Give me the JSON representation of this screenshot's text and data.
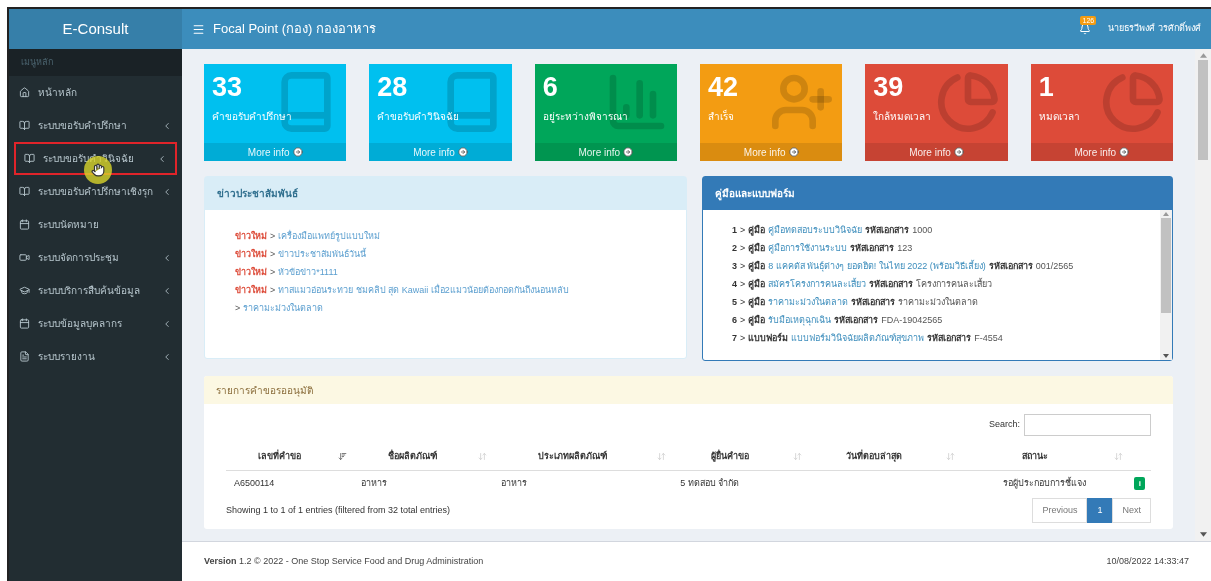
{
  "app": {
    "title": "E-Consult"
  },
  "header": {
    "title": "Focal Point (กอง) กองอาหาร",
    "notification_count": "126",
    "user": "นายธรวีพงศ์ วรศักดิ์พงศ์"
  },
  "sidebar": {
    "section": "เมนูหลัก",
    "items": [
      {
        "label": "หน้าหลัก",
        "has_submenu": false,
        "highlighted": false
      },
      {
        "label": "ระบบขอรับคำปรึกษา",
        "has_submenu": true,
        "highlighted": false
      },
      {
        "label": "ระบบขอรับคำวินิจฉัย",
        "has_submenu": true,
        "highlighted": true
      },
      {
        "label": "ระบบขอรับคำปรึกษาเชิงรุก",
        "has_submenu": true,
        "highlighted": false
      },
      {
        "label": "ระบบนัดหมาย",
        "has_submenu": false,
        "highlighted": false
      },
      {
        "label": "ระบบจัดการประชุม",
        "has_submenu": true,
        "highlighted": false
      },
      {
        "label": "ระบบบริการสืบค้นข้อมูล",
        "has_submenu": true,
        "highlighted": false
      },
      {
        "label": "ระบบข้อมูลบุคลากร",
        "has_submenu": true,
        "highlighted": false
      },
      {
        "label": "ระบบรายงาน",
        "has_submenu": true,
        "highlighted": false
      }
    ]
  },
  "stats": [
    {
      "value": "33",
      "label": "คำขอรับคำปรึกษา",
      "link": "More info",
      "color": "#00c0ef",
      "kind": "book"
    },
    {
      "value": "28",
      "label": "คำขอรับคำวินิจฉัย",
      "link": "More info",
      "color": "#00c0ef",
      "kind": "book"
    },
    {
      "value": "6",
      "label": "อยู่ระหว่างพิจารณา",
      "link": "More info",
      "color": "#00a65a",
      "kind": "chart"
    },
    {
      "value": "42",
      "label": "สำเร็จ",
      "link": "More info",
      "color": "#f39c12",
      "kind": "user"
    },
    {
      "value": "39",
      "label": "ใกล้หมดเวลา",
      "link": "More info",
      "color": "#dd4b39",
      "kind": "pie"
    },
    {
      "value": "1",
      "label": "หมดเวลา",
      "link": "More info",
      "color": "#dd4b39",
      "kind": "pie"
    }
  ],
  "news": {
    "title": "ข่าวประชาสัมพันธ์",
    "items": [
      {
        "tag": "ข่าวใหม่",
        "separator": ">",
        "text": "เครื่องมือแพทย์รูปแบบใหม่"
      },
      {
        "tag": "ข่าวใหม่",
        "separator": ">",
        "text": "ข่าวประชาสัมพันธ์วันนี้"
      },
      {
        "tag": "ข่าวใหม่",
        "separator": ">",
        "text": "หัวข้อข่าว*1111"
      },
      {
        "tag": "ข่าวใหม่",
        "separator": ">",
        "text": "ทาสแมวอ่อนระทวย ชมคลิป สุด Kawaii เมื่อ2แมวน้อยต้องกอดกันถึงนอนหลับ"
      },
      {
        "separator": ">",
        "text": "ราคามะม่วงในตลาด"
      }
    ]
  },
  "documents": {
    "title": "คู่มือและแบบฟอร์ม",
    "items": [
      {
        "number": "1",
        "separator": ">",
        "type": "คู่มือ",
        "title": "คู่มือทดสอบระบบวินิจฉัย",
        "code_label": "รหัสเอกสาร",
        "code": "1000"
      },
      {
        "number": "2",
        "separator": ">",
        "type": "คู่มือ",
        "title": "คู่มือการใช้งานระบบ",
        "code_label": "รหัสเอกสาร",
        "code": "123"
      },
      {
        "number": "3",
        "separator": ">",
        "type": "คู่มือ",
        "title": "8 แคคตัส พันธุ์ต่างๆ ยอดฮิต! ในไทย 2022 (พร้อมวิธีเลี้ยง)",
        "code_label": "รหัสเอกสาร",
        "code": "001/2565"
      },
      {
        "number": "4",
        "separator": ">",
        "type": "คู่มือ",
        "title": "สมัครโครงการคนละเสี้ยว",
        "code_label": "รหัสเอกสาร",
        "code": "โครงการคนละเสี้ยว"
      },
      {
        "number": "5",
        "separator": ">",
        "type": "คู่มือ",
        "title": "ราคามะม่วงในตลาด",
        "code_label": "รหัสเอกสาร",
        "code": "ราคามะม่วงในตลาด"
      },
      {
        "number": "6",
        "separator": ">",
        "type": "คู่มือ",
        "title": "รับมือเหตุฉุกเฉิน",
        "code_label": "รหัสเอกสาร",
        "code": "FDA-19042565"
      },
      {
        "number": "7",
        "separator": ">",
        "type": "แบบฟอร์ม",
        "title": "แบบฟอร์มวินิจฉัยผลิตภัณฑ์สุขภาพ",
        "code_label": "รหัสเอกสาร",
        "code": "F-4554"
      }
    ]
  },
  "requests": {
    "title": "รายการคำขอรออนุมัติ",
    "search_label": "Search:",
    "columns": [
      {
        "label": "เลขที่คำขอ",
        "sorted": true
      },
      {
        "label": "ชื่อผลิตภัณฑ์",
        "sorted": false
      },
      {
        "label": "ประเภทผลิตภัณฑ์",
        "sorted": false
      },
      {
        "label": "ผู้ยื่นคำขอ",
        "sorted": false
      },
      {
        "label": "วันที่ตอบล่าสุด",
        "sorted": false
      },
      {
        "label": "สถานะ",
        "sorted": false
      }
    ],
    "rows": [
      {
        "cells": [
          "A6500114",
          "อาหาร",
          "อาหาร",
          "5 ทดสอบ จำกัด",
          "",
          "รอผู้ประกอบการชี้แจง"
        ],
        "action": "i"
      }
    ],
    "info": "Showing 1 to 1 of 1 entries (filtered from 32 total entries)",
    "pagination": [
      {
        "label": "Previous",
        "selected": false
      },
      {
        "label": "1",
        "selected": true
      },
      {
        "label": "Next",
        "selected": false
      }
    ]
  },
  "footer": {
    "version_label": "Version",
    "version": "1.2 © 2022 - One Stop Service Food and Drug Administration",
    "timestamp": "10/08/2022 14:33:47"
  }
}
